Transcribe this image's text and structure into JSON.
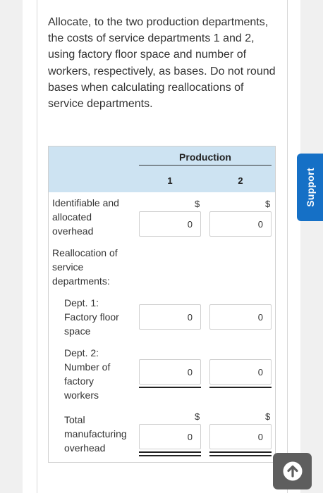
{
  "question": {
    "text": "Allocate, to the two production departments, the costs of service departments 1 and 2, using factory floor space and number of workers, respectively, as bases. Do not round bases when calculating reallocations of service departments."
  },
  "table": {
    "production_header": "Production",
    "columns": [
      "1",
      "2"
    ],
    "rows": {
      "identifiable": {
        "label": "Identifiable and allocated overhead",
        "currency": "$",
        "values": [
          "0",
          "0"
        ]
      },
      "reallocation": {
        "label": "Reallocation of service departments:"
      },
      "dept1": {
        "label": "Dept. 1: Factory floor space",
        "values": [
          "0",
          "0"
        ]
      },
      "dept2": {
        "label": "Dept. 2: Number of factory workers",
        "values": [
          "0",
          "0"
        ]
      },
      "total": {
        "label": "Total manufacturing overhead",
        "currency": "$",
        "values": [
          "0",
          "0"
        ]
      }
    }
  },
  "support_tab": {
    "label": "Support"
  },
  "scroll_top": {
    "icon": "arrow-up-circle-icon"
  },
  "colors": {
    "table_header_bg": "#cde3f2",
    "support_tab_bg": "#1570c6",
    "scroll_button_bg": "#5e5e5e"
  }
}
